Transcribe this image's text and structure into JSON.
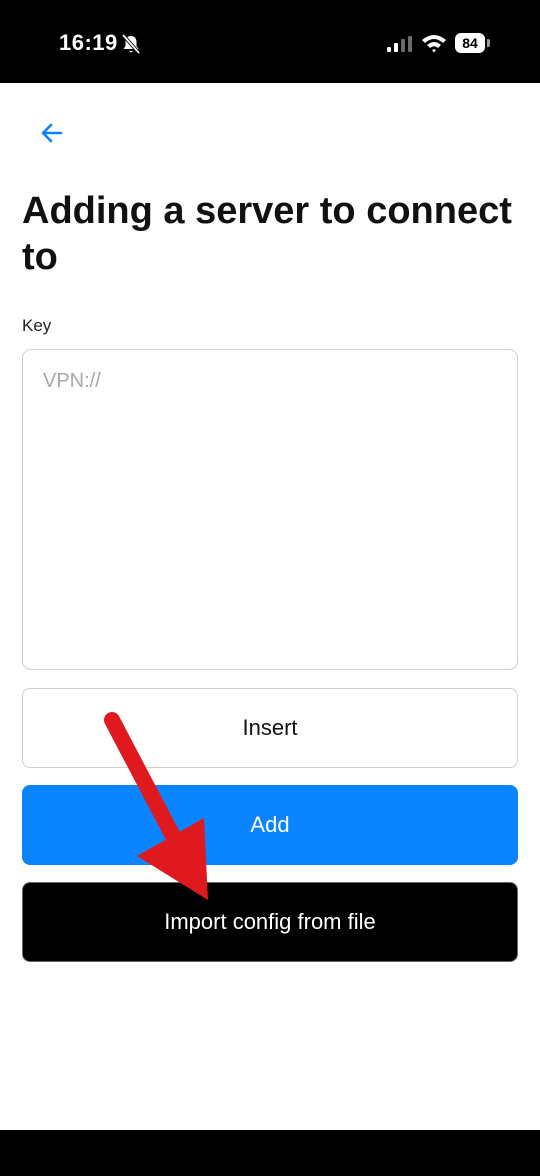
{
  "status_bar": {
    "time": "16:19",
    "battery": "84"
  },
  "header": {
    "back_icon": "arrow-left-icon",
    "title": "Adding a server to connect to"
  },
  "form": {
    "key_label": "Key",
    "key_placeholder": "VPN://",
    "key_value": ""
  },
  "buttons": {
    "insert": "Insert",
    "add": "Add",
    "import": "Import config from file"
  },
  "colors": {
    "accent": "#0a84ff",
    "annotation_arrow": "#e0191f"
  }
}
